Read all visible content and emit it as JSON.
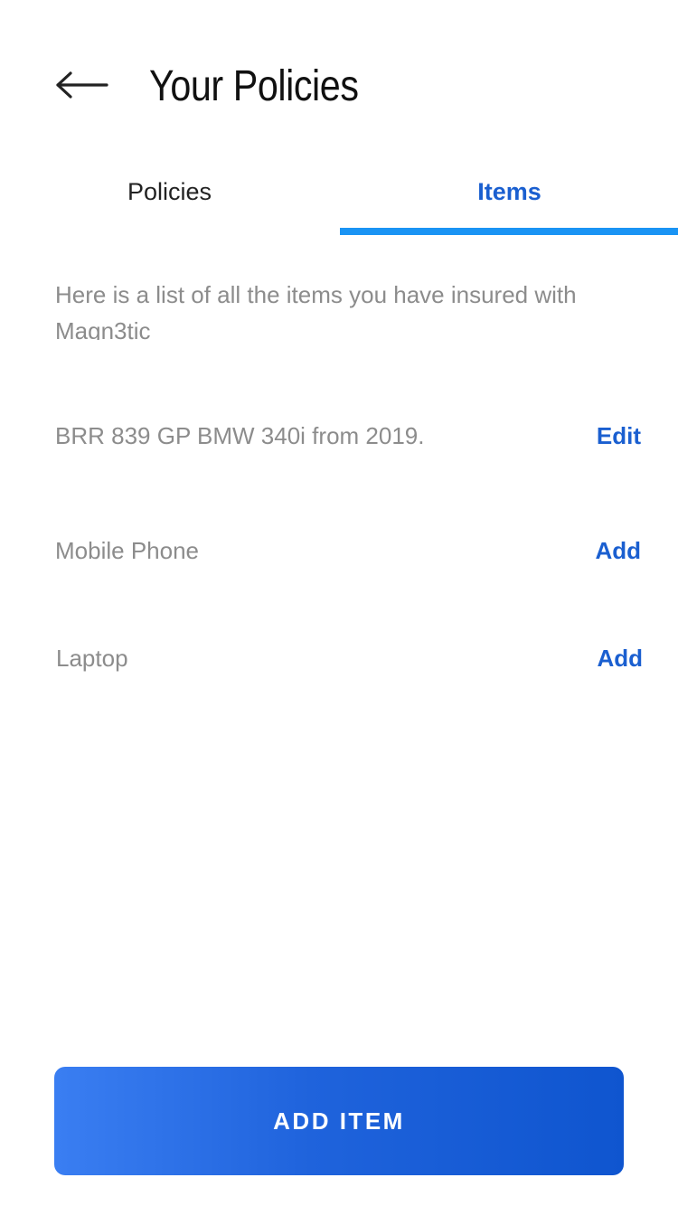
{
  "header": {
    "title": "Your Policies",
    "back_icon": "arrow-left-icon"
  },
  "tabs": [
    {
      "label": "Policies",
      "active": false
    },
    {
      "label": "Items",
      "active": true
    }
  ],
  "colors": {
    "accent": "#1a5fd0",
    "tab_indicator": "#1a94f4",
    "muted_text": "#8c8c8c",
    "button_gradient_start": "#3a7ef2",
    "button_gradient_end": "#0f55cf"
  },
  "intro_text": "Here is a list of all the items you have insured with Magn3tic",
  "items": [
    {
      "label": "BRR 839 GP BMW 340i from 2019.",
      "action": "Edit"
    },
    {
      "label": "Mobile Phone",
      "action": "Add"
    },
    {
      "label": "Laptop",
      "action": "Add"
    }
  ],
  "footer": {
    "add_button_label": "ADD ITEM"
  }
}
